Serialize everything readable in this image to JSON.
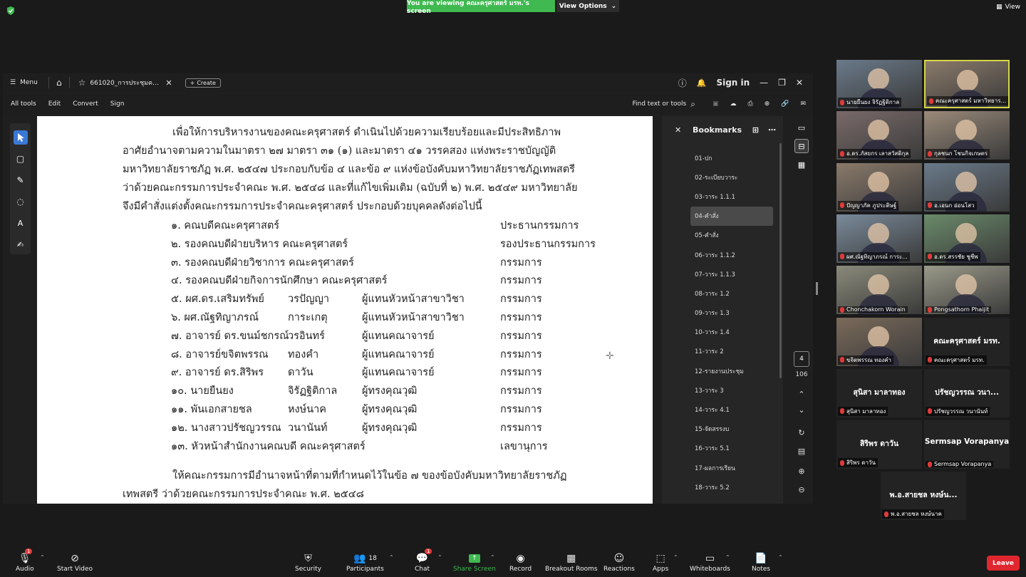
{
  "zoom": {
    "viewing_banner": "You are viewing คณะครุศาสตร์ มรท.'s screen",
    "view_options": "View Options",
    "view_label": "View"
  },
  "acrobat": {
    "menu_label": "Menu",
    "tab_name": "661020_การประชุมคณะกรร...",
    "create_label": "Create",
    "sign_in": "Sign in",
    "toolbar": {
      "all_tools": "All tools",
      "edit": "Edit",
      "convert": "Convert",
      "sign": "Sign",
      "find": "Find text or tools"
    },
    "bookmarks_title": "Bookmarks",
    "bookmarks": [
      "01-ปก",
      "02-ระเบียบวาระ",
      "03-วาระ 1.1.1",
      "04-คำสั่ง",
      "05-คำสั่ง",
      "06-วาระ 1.1.2",
      "07-วาระ 1.1.3",
      "08-วาระ 1.2",
      "09-วาระ 1.3",
      "10-วาระ 1.4",
      "11-วาระ 2",
      "12-รายงานประชุม",
      "13-วาระ 3",
      "14-วาระ 4.1",
      "15-จัดสรรงบ",
      "16-วาระ 5.1",
      "17-ผลการเรียน",
      "18-วาระ 5.2"
    ],
    "active_bookmark_index": 3,
    "page_current": "4",
    "page_total": "106"
  },
  "document": {
    "intro_lines": [
      "เพื่อให้การบริหารงานของคณะครุศาสตร์ ดำเนินไปด้วยความเรียบร้อยและมีประสิทธิภาพ",
      "อาศัยอำนาจตามความในมาตรา ๒๗ มาตรา ๓๑ (๑) และมาตรา ๔๑ วรรคสอง แห่งพระราชบัญญัติ",
      "มหาวิทยาลัยราชภัฏ พ.ศ. ๒๕๔๗ ประกอบกับข้อ ๔ และข้อ ๙ แห่งข้อบังคับมหาวิทยาลัยราชภัฏเทพสตรี",
      "ว่าด้วยคณะกรรมการประจำคณะ พ.ศ. ๒๕๔๘ และที่แก้ไขเพิ่มเติม (ฉบับที่ ๒) พ.ศ. ๒๕๔๙ มหาวิทยาลัย",
      "จึงมีคำสั่งแต่งตั้งคณะกรรมการประจำคณะครุศาสตร์ ประกอบด้วยบุคคลดังต่อไปนี้"
    ],
    "members": [
      {
        "name": "๑. คณบดีคณะครุศาสตร์",
        "surname": "",
        "role": "",
        "position": "ประธานกรรมการ"
      },
      {
        "name": "๒. รองคณบดีฝ่ายบริหาร  คณะครุศาสตร์",
        "surname": "",
        "role": "",
        "position": "รองประธานกรรมการ"
      },
      {
        "name": "๓. รองคณบดีฝ่ายวิชาการ  คณะครุศาสตร์",
        "surname": "",
        "role": "",
        "position": "กรรมการ"
      },
      {
        "name": "๔. รองคณบดีฝ่ายกิจการนักศึกษา  คณะครุศาสตร์",
        "surname": "",
        "role": "",
        "position": "กรรมการ"
      },
      {
        "name": "๕. ผศ.ดร.เสริมทรัพย์",
        "surname": "วรปัญญา",
        "role": "ผู้แทนหัวหน้าสาขาวิชา",
        "position": "กรรมการ"
      },
      {
        "name": "๖. ผศ.ณัฐทิญาภรณ์",
        "surname": "การะเกตุ",
        "role": "ผู้แทนหัวหน้าสาขาวิชา",
        "position": "กรรมการ"
      },
      {
        "name": "๗. อาจารย์ ดร.ขนม์ชกรณ์",
        "surname": "วรอินทร์",
        "role": "ผู้แทนคณาจารย์",
        "position": "กรรมการ"
      },
      {
        "name": "๘. อาจารย์ขจิตพรรณ",
        "surname": "ทองคำ",
        "role": "ผู้แทนคณาจารย์",
        "position": "กรรมการ"
      },
      {
        "name": "๙. อาจารย์ ดร.สิริพร",
        "surname": "ดาวัน",
        "role": "ผู้แทนคณาจารย์",
        "position": "กรรมการ"
      },
      {
        "name": "๑๐. นายยืนยง",
        "surname": "จิรัฏฐิติกาล",
        "role": "ผู้ทรงคุณวุฒิ",
        "position": "กรรมการ"
      },
      {
        "name": "๑๑. พันเอกสายชล",
        "surname": "หงษ์นาค",
        "role": "ผู้ทรงคุณวุฒิ",
        "position": "กรรมการ"
      },
      {
        "name": "๑๒. นางสาวปรัชญวรรณ",
        "surname": "วนานันท์",
        "role": "ผู้ทรงคุณวุฒิ",
        "position": "กรรมการ"
      },
      {
        "name": "๑๓. หัวหน้าสำนักงานคณบดี คณะครุศาสตร์",
        "surname": "",
        "role": "",
        "position": "เลขานุการ"
      }
    ],
    "closing_lines": [
      "ให้คณะกรรมการมีอำนาจหน้าที่ตามที่กำหนดไว้ในข้อ ๗ ของข้อบังคับมหาวิทยาลัยราชภัฏ",
      "เทพสตรี ว่าด้วยคณะกรรมการประจำคณะ พ.ศ. ๒๕๔๘"
    ]
  },
  "participants": [
    {
      "name": "นายยืนยง จิรัฏฐิติกาล",
      "video": true,
      "color": "#6a7a8a"
    },
    {
      "name": "คณะครุศาสตร์ มหาวิทยาร...",
      "video": true,
      "color": "#8a7a6a"
    },
    {
      "name": "อ.ดร.ภัสยกร เลาสวัสดิกุล",
      "video": true,
      "color": "#7a6a6a"
    },
    {
      "name": "กุลชนก โชนกิจเกษตร",
      "video": true,
      "color": "#9a8a7a"
    },
    {
      "name": "ปัญญาภัค ภูประดิษฐ์",
      "video": true,
      "color": "#8a7a6a"
    },
    {
      "name": "อ.เอนก อ่อนโสว",
      "video": true,
      "color": "#6a7a8a"
    },
    {
      "name": "ผศ.ณัฐทิญาภรณ์ การะ...",
      "video": true,
      "color": "#7a8a9a"
    },
    {
      "name": "อ.ดร.สรรชัย ชูชีพ",
      "video": true,
      "color": "#6a8a6a"
    },
    {
      "name": "Chonchakorn Worain",
      "video": true,
      "color": "#8a8a7a"
    },
    {
      "name": "Pongsathorn Phaijit",
      "video": true,
      "color": "#9a9a8a"
    },
    {
      "name": "ขจิตพรรณ ทองคำ",
      "video": true,
      "color": "#7a6a5a"
    },
    {
      "name": "คณะครุศาสตร์ มรท.",
      "video": false,
      "display": "คณะครุศาสตร์ มรท."
    },
    {
      "name": "สุนิสา มาลาทอง",
      "video": false,
      "display": "สุนิสา มาลาทอง"
    },
    {
      "name": "ปรัชญวรรณ วนานันท์",
      "video": false,
      "display": "ปรัชญวรรณ วนา..."
    },
    {
      "name": "สิริพร ดาวัน",
      "video": false,
      "display": "สิริพร ดาวัน"
    },
    {
      "name": "Sermsap Vorapanya",
      "video": false,
      "display": "Sermsap Vorapanya"
    },
    {
      "name": "พ.อ.สายชล หงษ์นาค",
      "video": false,
      "display": "พ.อ.สายชล หงษ์น..."
    }
  ],
  "bottom_bar": {
    "audio": "Audio",
    "audio_badge": "1",
    "start_video": "Start Video",
    "security": "Security",
    "participants": "Participants",
    "participants_count": "18",
    "chat": "Chat",
    "chat_badge": "1",
    "share_screen": "Share Screen",
    "record": "Record",
    "breakout": "Breakout Rooms",
    "reactions": "Reactions",
    "apps": "Apps",
    "whiteboards": "Whiteboards",
    "notes": "Notes",
    "leave": "Leave"
  },
  "colors": {
    "banner_green": "#3fb950",
    "leave_red": "#e0262e",
    "accent_blue": "#3a78d6"
  }
}
